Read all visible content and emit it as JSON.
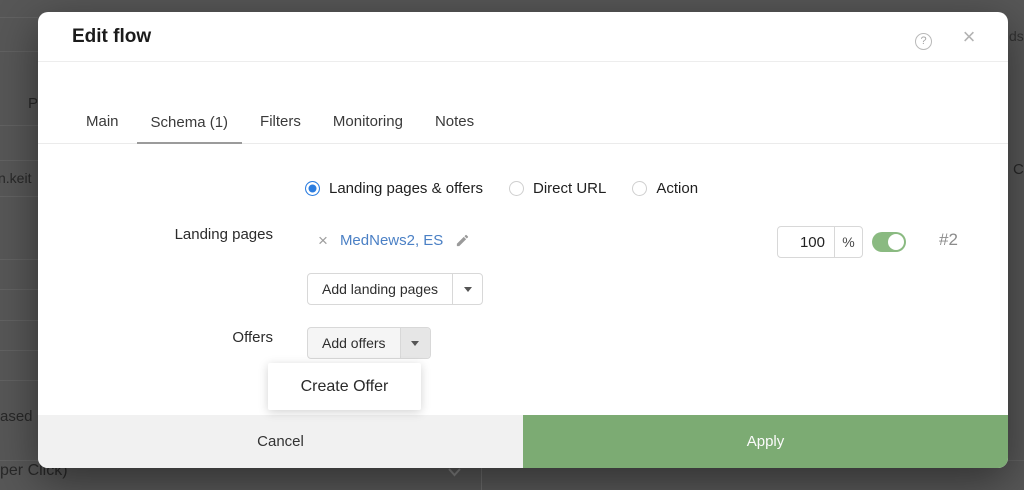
{
  "background": {
    "fragments": {
      "col_header_left": "P",
      "domain_fragment": "n.keit",
      "row_fragment": "ased",
      "bottom_row": "per Click)",
      "top_right": "ds",
      "col_header_right": "C"
    }
  },
  "modal": {
    "title": "Edit flow",
    "header_icons": {
      "help": "?",
      "close": "×"
    },
    "tabs": [
      {
        "label": "Main",
        "active": false
      },
      {
        "label": "Schema (1)",
        "active": true
      },
      {
        "label": "Filters",
        "active": false
      },
      {
        "label": "Monitoring",
        "active": false
      },
      {
        "label": "Notes",
        "active": false
      }
    ],
    "destination_radios": [
      {
        "label": "Landing pages & offers",
        "selected": true
      },
      {
        "label": "Direct URL",
        "selected": false
      },
      {
        "label": "Action",
        "selected": false
      }
    ],
    "landing_pages": {
      "label": "Landing pages",
      "item": {
        "remove_icon": "×",
        "name": "MedNews2, ES"
      },
      "weight_value": "100",
      "weight_unit": "%",
      "toggle_on": true,
      "flow_index": "#2",
      "add_button_label": "Add landing pages"
    },
    "offers": {
      "label": "Offers",
      "add_button_label": "Add offers",
      "dropdown_items": [
        {
          "label": "Create Offer"
        }
      ]
    },
    "footer": {
      "cancel_label": "Cancel",
      "apply_label": "Apply"
    }
  },
  "colors": {
    "accent_blue": "#2b7de0",
    "link_blue": "#4b80c5",
    "toggle_green": "#8aba81",
    "apply_green": "#7cab73",
    "scrim": "#575757"
  }
}
